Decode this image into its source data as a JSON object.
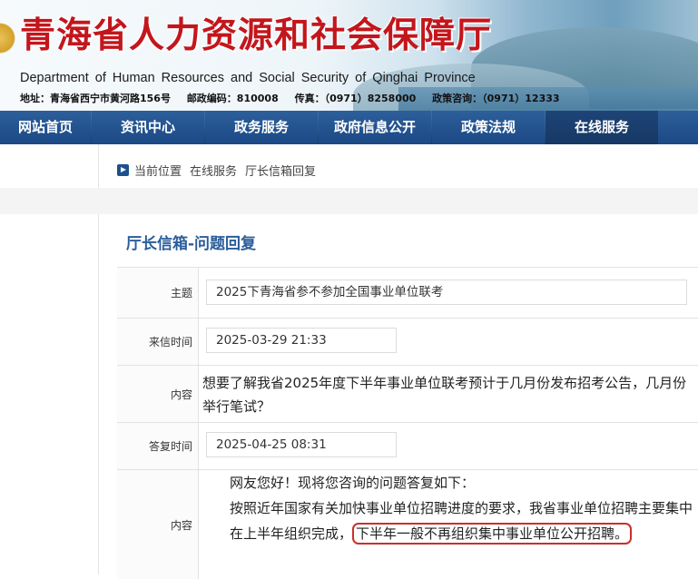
{
  "header": {
    "title": "青海省人力资源和社会保障厅",
    "english_name": "Department  of  Human  Resources and Social Security of Qinghai Province",
    "address": "地址：青海省西宁市黄河路156号",
    "postcode": "邮政编码：810008",
    "fax": "传真：（0971）8258000",
    "consult": "政策咨询：（0971）12333"
  },
  "nav": {
    "items": [
      {
        "label": "网站首页"
      },
      {
        "label": "资讯中心"
      },
      {
        "label": "政务服务"
      },
      {
        "label": "政府信息公开"
      },
      {
        "label": "政策法规"
      },
      {
        "label": "在线服务"
      }
    ],
    "active_index": 5
  },
  "breadcrumb": {
    "prefix": "当前位置",
    "items": [
      "在线服务",
      "厅长信箱回复"
    ]
  },
  "panel": {
    "title": "厅长信箱-问题回复"
  },
  "message": {
    "subject_label": "主题",
    "subject": "2025下青海省参不参加全国事业单位联考",
    "sent_label": "来信时间",
    "sent_time": "2025-03-29 21:33",
    "content_label": "内容",
    "content": "想要了解我省2025年度下半年事业单位联考预计于几月份发布招考公告，几月份举行笔试？",
    "reply_time_label": "答复时间",
    "reply_time": "2025-04-25 08:31",
    "reply_label": "内容",
    "reply_greeting": "网友您好！现将您咨询的问题答复如下：",
    "reply_body": "按照近年国家有关加快事业单位招聘进度的要求，我省事业单位招聘主要集中在上半年组织完成，",
    "reply_highlight": "下半年一般不再组织集中事业单位公开招聘。"
  },
  "colors": {
    "title_red": "#c3161c",
    "nav_blue": "#1b4985",
    "panel_title_blue": "#2a5d9c",
    "highlight_red": "#c9302c"
  }
}
